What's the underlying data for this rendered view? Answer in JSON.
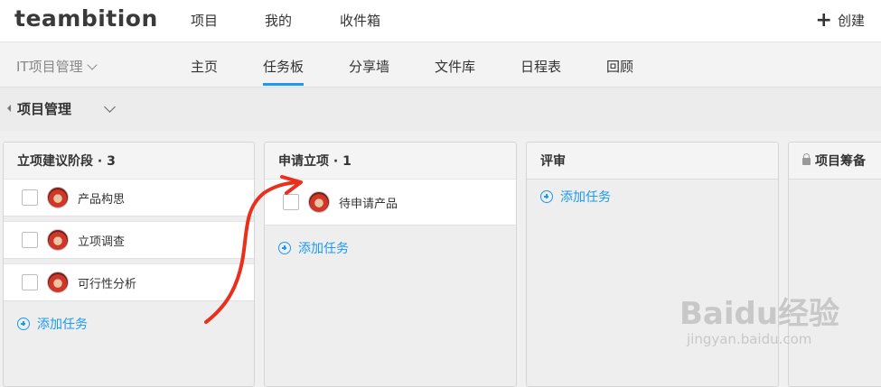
{
  "app": {
    "logo": "teambition"
  },
  "topnav": {
    "items": [
      "项目",
      "我的",
      "收件箱"
    ],
    "create_label": "创建"
  },
  "project_bar": {
    "project_name": "IT项目管理",
    "tabs": [
      "主页",
      "任务板",
      "分享墙",
      "文件库",
      "日程表",
      "回顾"
    ],
    "active_tab": "任务板"
  },
  "breadcrumb": {
    "title": "项目管理"
  },
  "columns": [
    {
      "title": "立项建议阶段 · 3",
      "cards": [
        "产品构思",
        "立项调查",
        "可行性分析"
      ],
      "add_label": "添加任务"
    },
    {
      "title": "申请立项 · 1",
      "cards": [
        "待申请产品"
      ],
      "add_label": "添加任务"
    },
    {
      "title": "评审",
      "cards": [],
      "add_label": "添加任务"
    },
    {
      "title": "项目筹备",
      "locked": true
    }
  ],
  "colors": {
    "accent": "#1b9aee",
    "annotation": "#e8301c"
  },
  "watermark": {
    "main": "Baidu经验",
    "sub": "jingyan.baidu.com"
  }
}
